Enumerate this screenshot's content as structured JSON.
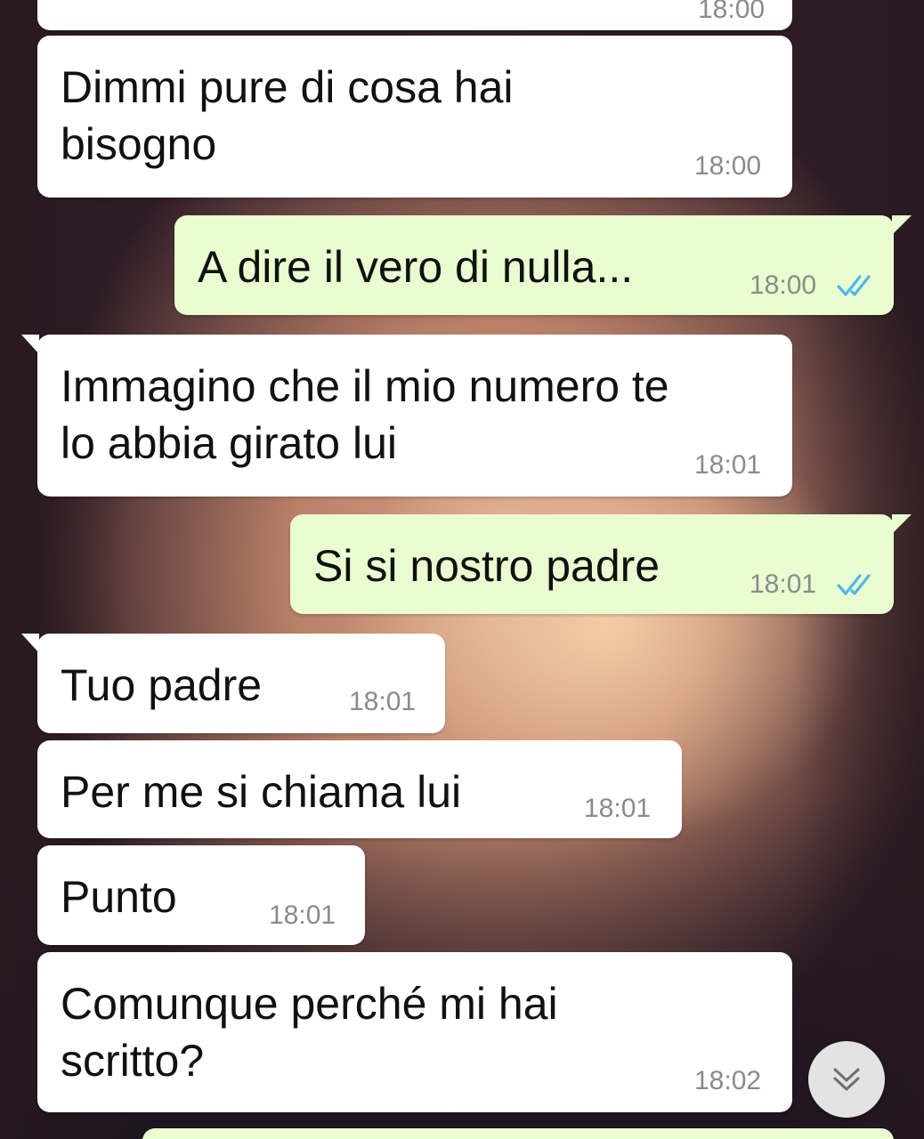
{
  "messages": [
    {
      "direction": "incoming",
      "time": "18:00"
    },
    {
      "direction": "incoming",
      "text": "Dimmi pure di cosa hai\nbisogno",
      "time": "18:00"
    },
    {
      "direction": "outgoing",
      "text": "A dire il vero di nulla...",
      "time": "18:00",
      "status": "read"
    },
    {
      "direction": "incoming",
      "text": "Immagino che il mio numero te\nlo abbia girato lui",
      "time": "18:01"
    },
    {
      "direction": "outgoing",
      "text": "Si si nostro padre",
      "time": "18:01",
      "status": "read"
    },
    {
      "direction": "incoming",
      "text": "Tuo padre",
      "time": "18:01"
    },
    {
      "direction": "incoming",
      "text": "Per me si chiama lui",
      "time": "18:01"
    },
    {
      "direction": "incoming",
      "text": "Punto",
      "time": "18:01"
    },
    {
      "direction": "incoming",
      "text": "Comunque perché mi hai\nscritto?",
      "time": "18:02"
    }
  ],
  "colors": {
    "incoming_bubble": "#ffffff",
    "outgoing_bubble": "#e9fdd0",
    "read_ticks": "#4fb6ec",
    "timestamp": "#8b8b8b"
  },
  "icons": {
    "read_receipt": "double-check-icon",
    "scroll_down": "chevron-double-down-icon"
  }
}
